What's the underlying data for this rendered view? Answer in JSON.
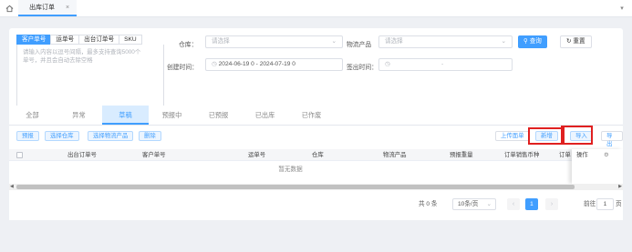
{
  "topbar": {
    "tab_label": "出库订单",
    "tab_close": "×",
    "more": "▾"
  },
  "search": {
    "type_tabs": [
      "客户单号",
      "运单号",
      "出台订单号",
      "SKU"
    ],
    "textarea_placeholder_line1": "请输入内容以逗号间隔，最多支持查询5000个",
    "textarea_placeholder_line2": "单号，并且会自动去除空格",
    "warehouse_label": "仓库：",
    "warehouse_placeholder": "请选择",
    "product_label": "物流产品",
    "product_placeholder": "请选择",
    "created_label": "创建时间：",
    "date_range": "2024-06-19 0  -  2024-07-19 0",
    "outbound_label": "签出时间：",
    "outbound_sep": "-",
    "query_button": "查询",
    "reset_button": "重置"
  },
  "orders": {
    "tabs": [
      "全部",
      "异常",
      "草稿",
      "预报中",
      "已预报",
      "已出库",
      "已作废"
    ],
    "active_tab": "草稿",
    "left_actions": [
      "预报",
      "选择仓库",
      "选择物流产品",
      "删除"
    ],
    "right_actions": [
      "上传面单",
      "新增",
      "导入",
      "导出"
    ],
    "columns": [
      "出台订单号",
      "客户单号",
      "运单号",
      "仓库",
      "物流产品",
      "预报重量",
      "订单销售币种",
      "订单"
    ],
    "operation_col": "操作",
    "empty_text": "暂无数据"
  },
  "pagination": {
    "total": "共 0 条",
    "page_size": "10条/页",
    "current_page": "1",
    "goto_label": "前往",
    "goto_value": "1",
    "page_suffix": "页"
  },
  "colors": {
    "primary": "#409eff",
    "highlight": "#e02020"
  }
}
